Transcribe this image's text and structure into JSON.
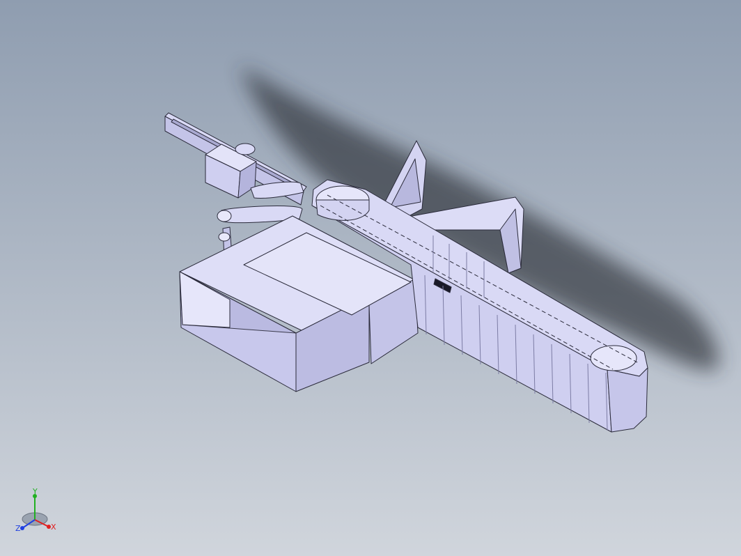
{
  "viewport": {
    "background_top": "#8f9db0",
    "background_bottom": "#d0d5dc",
    "model_fill": "#d9d9f5",
    "model_shade": "#c4c4e8",
    "model_dark": "#a9a9d0",
    "edge_color": "#2a2a3a",
    "shadow_color": "#2b2f36"
  },
  "triad": {
    "x_label": "X",
    "y_label": "Y",
    "z_label": "Z",
    "x_color": "#e02020",
    "y_color": "#20b020",
    "z_color": "#2040e0"
  }
}
